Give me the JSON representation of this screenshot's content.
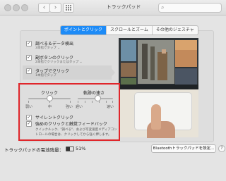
{
  "window": {
    "title": "トラックパッド",
    "search_placeholder": ""
  },
  "tabs": [
    {
      "label": "ポイントとクリック",
      "active": true
    },
    {
      "label": "スクロールとズーム",
      "active": false
    },
    {
      "label": "その他のジェスチャ",
      "active": false
    }
  ],
  "options": [
    {
      "label": "調べる＆データ検出",
      "sub": "3本指でタップ ⌄",
      "checked": true
    },
    {
      "label": "副ボタンのクリック",
      "sub": "2本指でクリックまたはタップ ⌄",
      "checked": true
    },
    {
      "label": "タップでクリック",
      "sub": "1本指でタップ",
      "checked": true
    }
  ],
  "click_section": {
    "click_label": "クリック",
    "click_min": "弱い",
    "click_mid": "中",
    "click_max": "強い",
    "click_level": 0.5,
    "speed_label": "軌跡の速さ",
    "speed_min": "遅い",
    "speed_max": "速い",
    "speed_level": 0.55,
    "silent_label": "サイレントクリック",
    "silent_checked": true,
    "force_label": "強めのクリックと触覚フィードバック",
    "force_desc_1": "クイックルック、\"調べる\"、および可変速度メディアコン",
    "force_desc_2": "トロールの場合は、クリックしてから強く押します。",
    "force_checked": true
  },
  "bottom": {
    "battery_label": "トラックパッドの電池残量：",
    "battery_pct": "51%",
    "battery_level": 0.51,
    "bt_button": "Bluetoothトラックパッドを設定...",
    "help": "?"
  },
  "icons": {
    "back": "chevron-left-icon",
    "forward": "chevron-right-icon",
    "grid": "grid-icon",
    "search": "search-icon",
    "check": "✓"
  }
}
